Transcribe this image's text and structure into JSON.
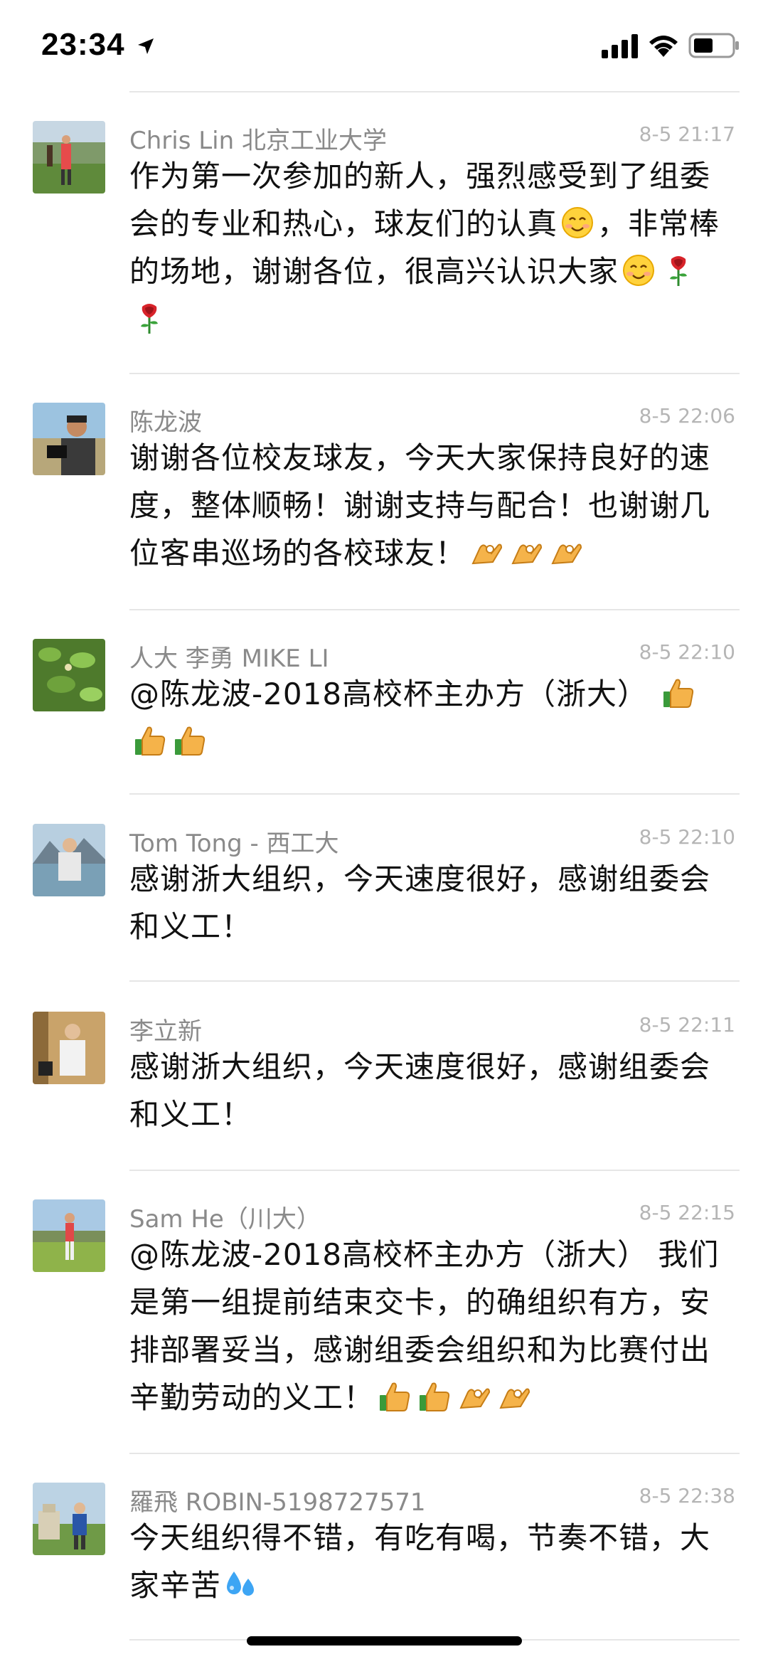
{
  "status_bar": {
    "time": "23:34",
    "icons": [
      "location-arrow-icon",
      "cellular-signal-icon",
      "wifi-icon",
      "battery-icon"
    ]
  },
  "comments": [
    {
      "author": "Chris Lin 北京工业大学",
      "time": "8-5 21:17",
      "text_parts": [
        "作为第一次参加的新人，强烈感受到了组委会的专业和热心，球友们的认真",
        "，非常棒的场地，谢谢各位，很高兴认识大家"
      ],
      "emojis": [
        "smile-emoji",
        "smile-emoji",
        "rose-emoji",
        "rose-emoji"
      ]
    },
    {
      "author": "陈龙波",
      "time": "8-5 22:06",
      "text_parts": [
        "谢谢各位校友球友，今天大家保持良好的速度，整体顺畅！谢谢支持与配合！也谢谢几位客串巡场的各校球友！"
      ],
      "emojis": [
        "ok-hand-emoji",
        "ok-hand-emoji",
        "ok-hand-emoji"
      ]
    },
    {
      "author": "人大 李勇 MIKE LI",
      "time": "8-5 22:10",
      "text_parts": [
        "@陈龙波-2018高校杯主办方（浙大）"
      ],
      "emojis": [
        "thumbs-up-emoji",
        "thumbs-up-emoji",
        "thumbs-up-emoji"
      ]
    },
    {
      "author": "Tom Tong - 西工大",
      "time": "8-5 22:10",
      "text_parts": [
        "感谢浙大组织，今天速度很好，感谢组委会和义工！"
      ],
      "emojis": []
    },
    {
      "author": "李立新",
      "time": "8-5 22:11",
      "text_parts": [
        "感谢浙大组织，今天速度很好，感谢组委会和义工！"
      ],
      "emojis": []
    },
    {
      "author": "Sam He（川大）",
      "time": "8-5 22:15",
      "text_parts": [
        "@陈龙波-2018高校杯主办方（浙大） 我们是第一组提前结束交卡，的确组织有方，安排部署妥当，感谢组委会组织和为比赛付出辛勤劳动的义工！"
      ],
      "emojis": [
        "thumbs-up-emoji",
        "thumbs-up-emoji",
        "ok-hand-emoji",
        "ok-hand-emoji"
      ]
    },
    {
      "author": "羅飛 ROBIN-5198727571",
      "time": "8-5 22:38",
      "text_parts": [
        "今天组织得不错，有吃有喝，节奏不错，大家辛苦"
      ],
      "emojis": [
        "sweat-droplets-emoji"
      ]
    }
  ],
  "colors": {
    "author": "#8a8a8a",
    "timestamp": "#b5b5b5",
    "divider": "#e6e6e6",
    "text": "#111111"
  }
}
